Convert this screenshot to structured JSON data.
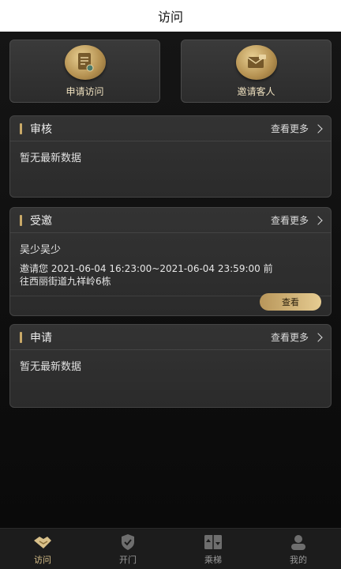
{
  "header": {
    "title": "访问"
  },
  "actions": [
    {
      "label": "申请访问",
      "icon": "document-icon"
    },
    {
      "label": "邀请客人",
      "icon": "envelope-icon"
    }
  ],
  "review": {
    "title": "审核",
    "more": "查看更多",
    "empty": "暂无最新数据"
  },
  "invited": {
    "title": "受邀",
    "more": "查看更多",
    "name": "吴少吴少",
    "line1": "邀请您 2021-06-04 16:23:00~2021-06-04 23:59:00 前",
    "line2": "往西丽街道九祥岭6栋",
    "button": "查看"
  },
  "apply": {
    "title": "申请",
    "more": "查看更多",
    "empty": "暂无最新数据"
  },
  "tabbar": {
    "items": [
      {
        "label": "访问",
        "icon": "handshake-icon",
        "active": true
      },
      {
        "label": "开门",
        "icon": "shield-icon",
        "active": false
      },
      {
        "label": "乘梯",
        "icon": "elevator-icon",
        "active": false
      },
      {
        "label": "我的",
        "icon": "user-icon",
        "active": false
      }
    ]
  },
  "colors": {
    "accent": "#c9a968",
    "background": "#0d0d0d",
    "card": "#2f2f2f"
  }
}
